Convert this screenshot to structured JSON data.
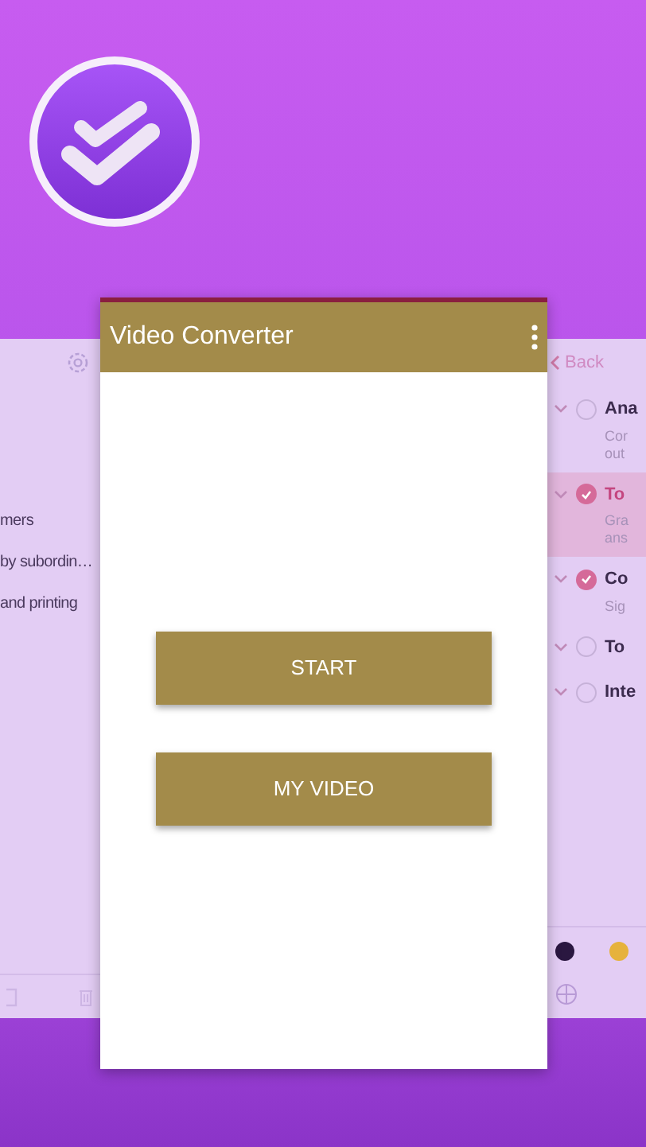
{
  "left_panel": {
    "items": [
      "mers",
      "by subordin…",
      "and printing"
    ]
  },
  "app": {
    "title": "Video Converter",
    "buttons": [
      "START",
      "MY VIDEO"
    ]
  },
  "right_panel": {
    "back": "Back",
    "tasks": [
      {
        "title": "Ana",
        "note": [
          "Cor",
          "out"
        ],
        "checked": false,
        "selected": false
      },
      {
        "title": "To",
        "note": [
          "Gra",
          "ans"
        ],
        "checked": true,
        "selected": true
      },
      {
        "title": "Co",
        "note": [
          "Sig"
        ],
        "checked": true,
        "selected": false
      },
      {
        "title": "To",
        "checked": false,
        "selected": false
      },
      {
        "title": "Inte",
        "checked": false,
        "selected": false
      }
    ],
    "swatches": [
      {
        "color": "#2a1740"
      },
      {
        "color": "#e6b23c"
      }
    ]
  }
}
